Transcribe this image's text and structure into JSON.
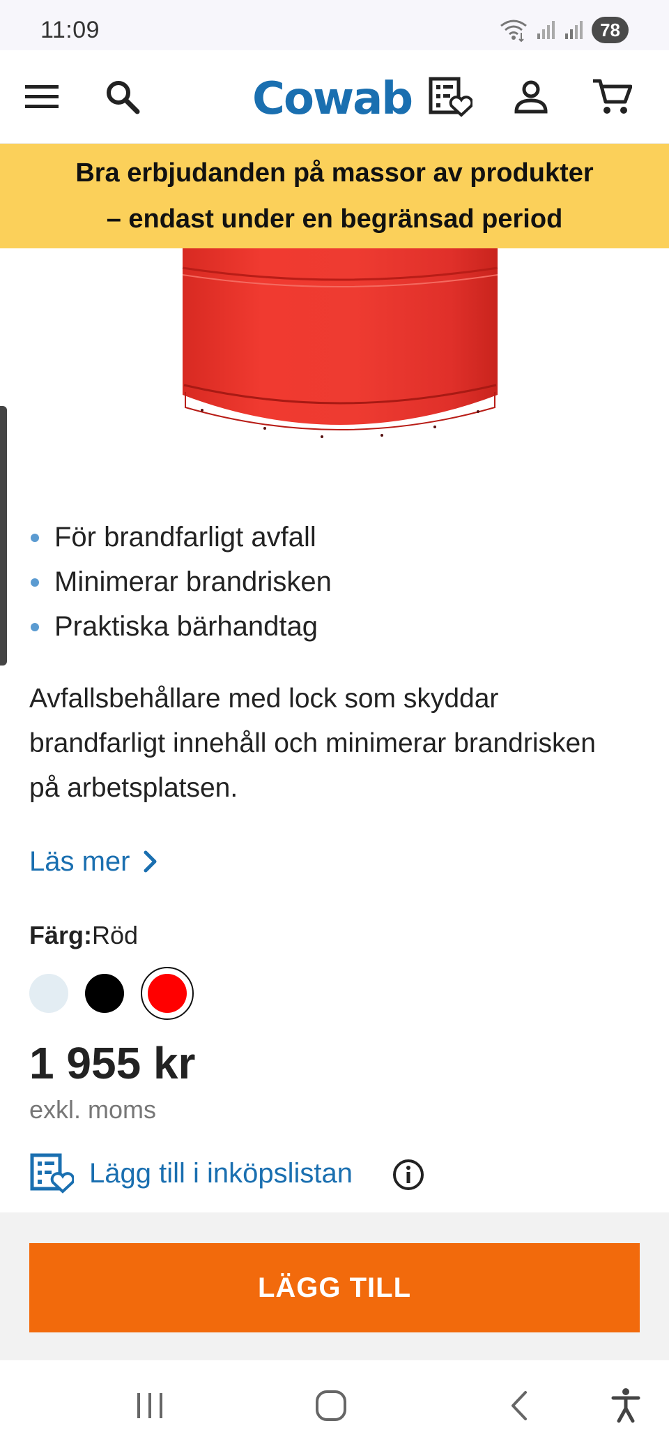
{
  "status_bar": {
    "time": "11:09",
    "battery": "78"
  },
  "header": {
    "logo": "Cowab"
  },
  "promo": {
    "line1": "Bra erbjudanden på massor av produkter",
    "line2": "– endast under en begränsad period"
  },
  "product": {
    "bullets": [
      "För brandfarligt avfall",
      "Minimerar brandrisken",
      "Praktiska bärhandtag"
    ],
    "description": "Avfallsbehållare med lock som skyddar brandfarligt innehåll och minimerar brandrisken på arbetsplatsen.",
    "read_more": "Läs mer",
    "color_label": "Färg:",
    "color_value": "Röd",
    "colors": [
      "#e3edf3",
      "#000000",
      "#ff0000"
    ],
    "selected_color": "Röd",
    "price": "1 955 kr",
    "vat_note": "exkl. moms",
    "add_to_list": "Lägg till i inköpslistan",
    "cta": "LÄGG TILL"
  },
  "theme": {
    "brand": "#1a6fb0",
    "banner": "#fbd05a",
    "cta": "#f26a0c"
  }
}
